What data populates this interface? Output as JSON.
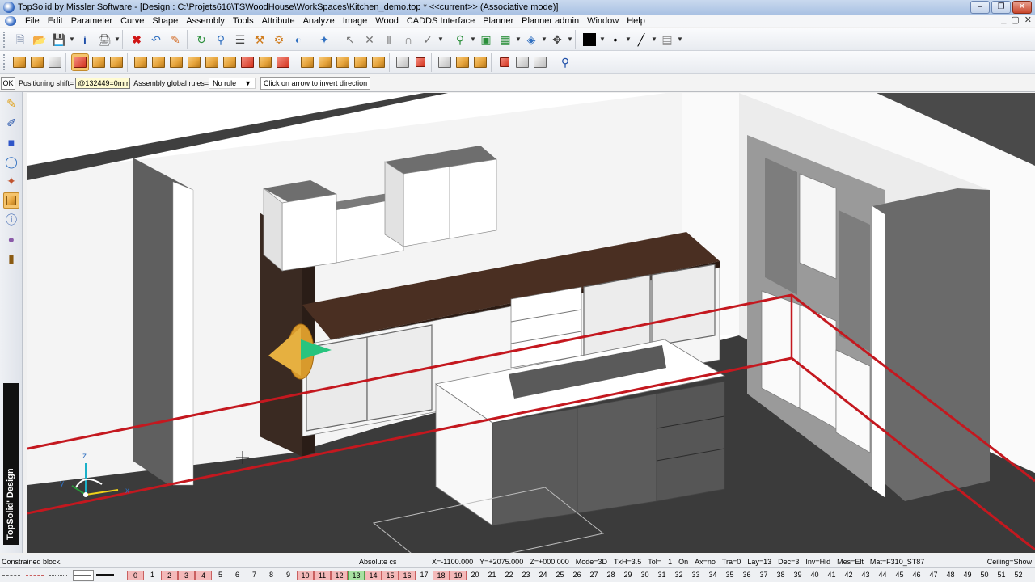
{
  "window": {
    "title": "TopSolid by Missler Software - [Design : C:\\Projets616\\TSWoodHouse\\WorkSpaces\\Kitchen_demo.top *  <<current>> (Associative mode)]",
    "controls": [
      "minimize",
      "restore",
      "close"
    ]
  },
  "menubar": {
    "items": [
      "File",
      "Edit",
      "Parameter",
      "Curve",
      "Shape",
      "Assembly",
      "Tools",
      "Attribute",
      "Analyze",
      "Image",
      "Wood",
      "CADDS Interface",
      "Planner",
      "Planner admin",
      "Window",
      "Help"
    ],
    "mdi_controls": [
      "_",
      "▢",
      "✕"
    ]
  },
  "toolbar1": {
    "icons": [
      "new-doc-icon",
      "open-folder-icon",
      "save-icon",
      "info-icon",
      "print-icon",
      "delete-icon",
      "undo-icon",
      "eraser-icon",
      "regen-icon",
      "zoom-dynamic-icon",
      "parameters-icon",
      "hammer-icon",
      "tools-icon",
      "measure-icon",
      "select-icon",
      "pick-icon",
      "cut-icon",
      "pillars-icon",
      "magnet-icon",
      "sketch-icon",
      "zoom-in-icon",
      "zoom-fit-icon",
      "layer-icon",
      "view-icon",
      "move-icon",
      "color-swatch-icon",
      "dot-icon",
      "line-style-icon",
      "hatch-icon"
    ],
    "color_swatch": "#000000"
  },
  "toolbar2": {
    "active_index": 0,
    "icons": [
      "cabinet-red-icon",
      "cabinet-icon",
      "cabinet-icon",
      "cabinet-icon",
      "cabinet-icon",
      "cabinet-icon",
      "cabinet-icon",
      "cabinet-icon",
      "cabinet-icon",
      "cabinet-icon",
      "cabinet-icon",
      "cabinet-icon",
      "cabinet-icon",
      "cabinet-icon",
      "cabinet-icon",
      "cabinet-icon",
      "cabinet-icon",
      "cabinet-icon",
      "cabinet-red-icon",
      "cabinet-gray-icon",
      "cabinet-icon",
      "cabinet-red-icon",
      "cabinet-gray-icon",
      "cabinet-gray-icon",
      "search-icon"
    ]
  },
  "optionbar": {
    "ok_label": "OK",
    "positioning_label": "Positioning shift=",
    "positioning_value": "@132449=0mm",
    "assembly_label": "Assembly global rules=",
    "assembly_value": "No rule",
    "message": "Click on arrow to invert direction"
  },
  "lefttools": {
    "icons": [
      "pencil-icon",
      "edit-icon",
      "solid-icon",
      "circle-icon",
      "coordinate-icon",
      "cabinet-icon",
      "info-icon",
      "part-icon",
      "panel-icon"
    ],
    "active_index": 5,
    "brand": "TopSolid' Design"
  },
  "viewport": {
    "axis_labels": {
      "x": "x",
      "y": "y",
      "z": "z"
    },
    "colors": {
      "wall": "#f3f3f3",
      "floor": "#3a3a3a",
      "countertop": "#4a2f22",
      "cabinet": "#ffffff",
      "carcass": "#5a5a5a",
      "red_line": "#c4181f",
      "cone": "#e1a53b",
      "arrow": "#28c47e"
    }
  },
  "statusbar": {
    "message": "Constrained block.",
    "coord_system": "Absolute cs",
    "x": "X=-1100.000",
    "y": "Y=+2075.000",
    "z": "Z=+000.000",
    "mode": "Mode=3D",
    "txh": "TxH=3.5",
    "tol_label": "Tol=",
    "tol_value": "1",
    "on": "On",
    "ax": "Ax=no",
    "tra": "Tra=0",
    "lay": "Lay=13",
    "dec": "Dec=3",
    "inv": "Inv=Hid",
    "mes": "Mes=Elt",
    "mat": "Mat=F310_ST87",
    "ceiling": "Ceiling=Show"
  },
  "layerbar": {
    "numbers": [
      "0",
      "1",
      "2",
      "3",
      "4",
      "5",
      "6",
      "7",
      "8",
      "9",
      "10",
      "11",
      "12",
      "13",
      "14",
      "15",
      "16",
      "17",
      "18",
      "19",
      "20",
      "21",
      "22",
      "23",
      "24",
      "25",
      "26",
      "27",
      "28",
      "29",
      "30",
      "31",
      "32",
      "33",
      "34",
      "35",
      "36",
      "37",
      "38",
      "39",
      "40",
      "41",
      "42",
      "43",
      "44",
      "45",
      "46",
      "47",
      "48",
      "49",
      "50",
      "51",
      "52"
    ],
    "active_layers": [
      "0",
      "2",
      "3",
      "4",
      "10",
      "11",
      "12",
      "14",
      "15",
      "16",
      "18",
      "19"
    ],
    "current_layer": "13"
  }
}
